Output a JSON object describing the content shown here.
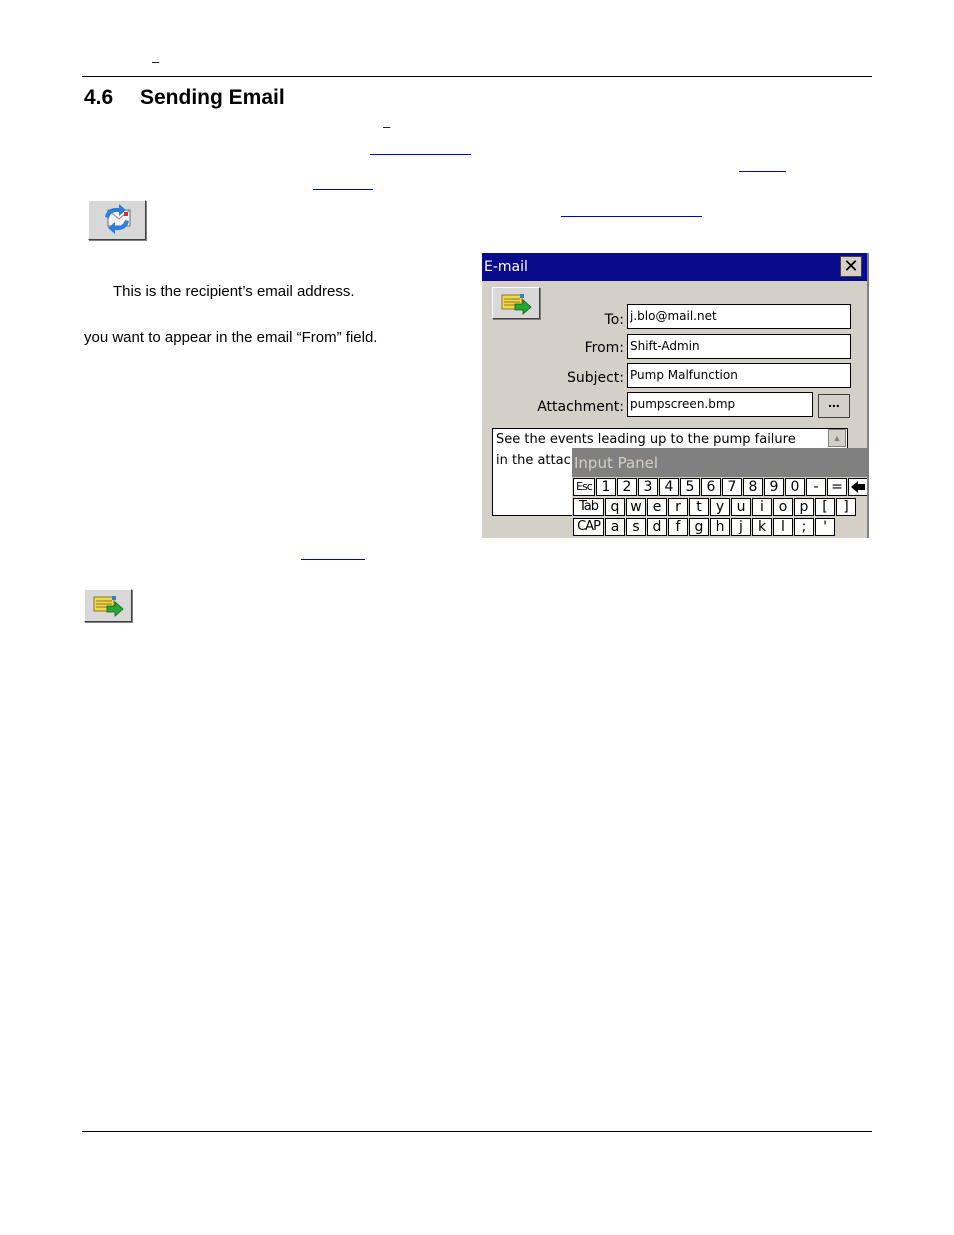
{
  "header": {
    "dash": "–"
  },
  "section": {
    "number": "4.6",
    "title": "Sending Email"
  },
  "intro": {
    "dash": "–"
  },
  "fields_text": {
    "to_description": "This is the recipient’s email address.",
    "from_description": "you want to appear in the email “From” field."
  },
  "dialog": {
    "title": "E-mail",
    "close": "✕",
    "to_label": "To:",
    "to_value": "j.blo@mail.net",
    "from_label": "From:",
    "from_value": "Shift-Admin",
    "subject_label": "Subject:",
    "subject_value": "Pump Malfunction",
    "attachment_label": "Attachment:",
    "attachment_value": "pumpscreen.bmp",
    "browse": "...",
    "body_line1": "See the events leading up to the pump failure",
    "body_line2": "in the attac",
    "input_panel": {
      "title": "Input Panel",
      "row1": [
        "Esc",
        "1",
        "2",
        "3",
        "4",
        "5",
        "6",
        "7",
        "8",
        "9",
        "0",
        "-",
        "=",
        "🡄"
      ],
      "row2": [
        "Tab",
        "q",
        "w",
        "e",
        "r",
        "t",
        "y",
        "u",
        "i",
        "o",
        "p",
        "[",
        "]"
      ],
      "row3": [
        "CAP",
        "a",
        "s",
        "d",
        "f",
        "g",
        "h",
        "j",
        "k",
        "l",
        ";",
        "'"
      ]
    }
  },
  "icons": {
    "send_receive": "send-receive-icon",
    "send": "send-email-icon"
  }
}
